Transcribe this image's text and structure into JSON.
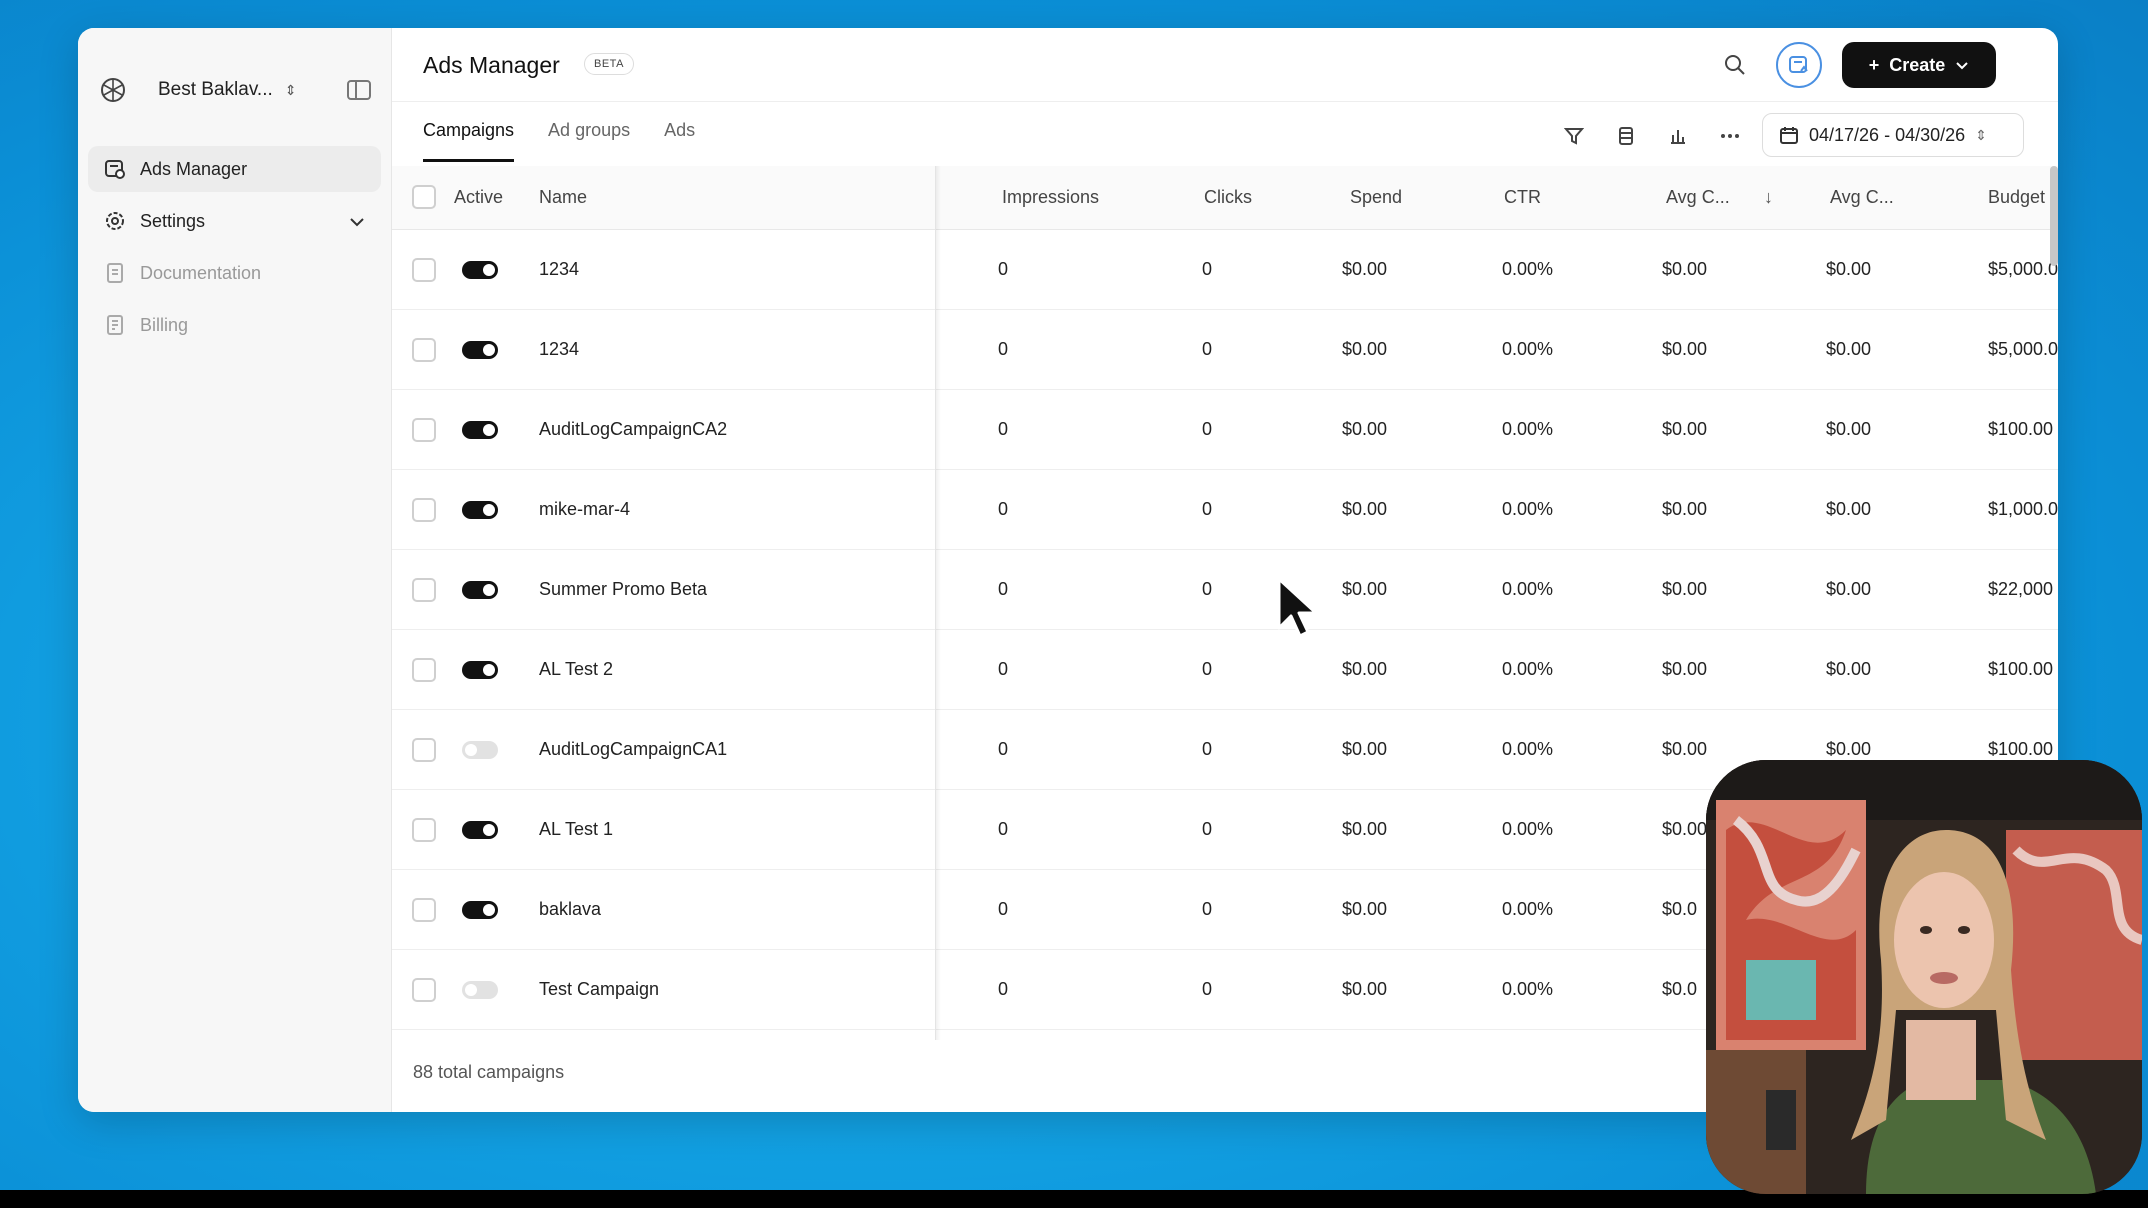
{
  "workspace": {
    "name": "Best Baklav..."
  },
  "sidebar": {
    "items": [
      {
        "label": "Ads Manager",
        "icon": "ads-manager-icon",
        "state": "active"
      },
      {
        "label": "Settings",
        "icon": "gear-icon",
        "state": "normal"
      },
      {
        "label": "Documentation",
        "icon": "document-icon",
        "state": "muted"
      },
      {
        "label": "Billing",
        "icon": "billing-icon",
        "state": "muted"
      }
    ]
  },
  "header": {
    "title": "Ads Manager",
    "badge": "BETA",
    "create_label": "Create"
  },
  "tabs": [
    {
      "label": "Campaigns",
      "active": true
    },
    {
      "label": "Ad groups",
      "active": false
    },
    {
      "label": "Ads",
      "active": false
    }
  ],
  "toolbar": {
    "date_range": "04/17/26 - 04/30/26"
  },
  "table": {
    "headers": {
      "active": "Active",
      "name": "Name",
      "impressions": "Impressions",
      "clicks": "Clicks",
      "spend": "Spend",
      "ctr": "CTR",
      "avg1": "Avg C...",
      "avg2": "Avg C...",
      "budget": "Budget"
    },
    "rows": [
      {
        "active": true,
        "name": "1234",
        "impressions": "0",
        "clicks": "0",
        "spend": "$0.00",
        "ctr": "0.00%",
        "avg1": "$0.00",
        "avg2": "$0.00",
        "budget": "$5,000.0"
      },
      {
        "active": true,
        "name": "1234",
        "impressions": "0",
        "clicks": "0",
        "spend": "$0.00",
        "ctr": "0.00%",
        "avg1": "$0.00",
        "avg2": "$0.00",
        "budget": "$5,000.0"
      },
      {
        "active": true,
        "name": "AuditLogCampaignCA2",
        "impressions": "0",
        "clicks": "0",
        "spend": "$0.00",
        "ctr": "0.00%",
        "avg1": "$0.00",
        "avg2": "$0.00",
        "budget": "$100.00"
      },
      {
        "active": true,
        "name": "mike-mar-4",
        "impressions": "0",
        "clicks": "0",
        "spend": "$0.00",
        "ctr": "0.00%",
        "avg1": "$0.00",
        "avg2": "$0.00",
        "budget": "$1,000.0"
      },
      {
        "active": true,
        "name": "Summer Promo Beta",
        "impressions": "0",
        "clicks": "0",
        "spend": "$0.00",
        "ctr": "0.00%",
        "avg1": "$0.00",
        "avg2": "$0.00",
        "budget": "$22,000"
      },
      {
        "active": true,
        "name": "AL Test 2",
        "impressions": "0",
        "clicks": "0",
        "spend": "$0.00",
        "ctr": "0.00%",
        "avg1": "$0.00",
        "avg2": "$0.00",
        "budget": "$100.00"
      },
      {
        "active": false,
        "name": "AuditLogCampaignCA1",
        "impressions": "0",
        "clicks": "0",
        "spend": "$0.00",
        "ctr": "0.00%",
        "avg1": "$0.00",
        "avg2": "$0.00",
        "budget": "$100.00"
      },
      {
        "active": true,
        "name": "AL Test 1",
        "impressions": "0",
        "clicks": "0",
        "spend": "$0.00",
        "ctr": "0.00%",
        "avg1": "$0.00",
        "avg2": "",
        "budget": ""
      },
      {
        "active": true,
        "name": "baklava",
        "impressions": "0",
        "clicks": "0",
        "spend": "$0.00",
        "ctr": "0.00%",
        "avg1": "$0.0",
        "avg2": "",
        "budget": ""
      },
      {
        "active": false,
        "name": "Test Campaign",
        "impressions": "0",
        "clicks": "0",
        "spend": "$0.00",
        "ctr": "0.00%",
        "avg1": "$0.0",
        "avg2": "",
        "budget": ""
      }
    ]
  },
  "footer": {
    "total": "88 total campaigns"
  },
  "colors": {
    "accent": "#111111",
    "background": "#12a0e2",
    "badge_ring": "#4a90e2"
  }
}
